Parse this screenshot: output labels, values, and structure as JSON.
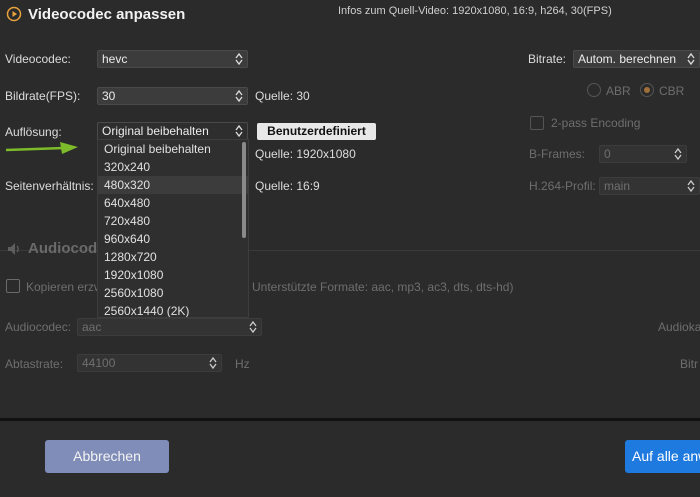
{
  "title": "Videocodec anpassen",
  "source_info": "Infos zum Quell-Video: 1920x1080, 16:9, h264, 30(FPS)",
  "video": {
    "codec_label": "Videocodec:",
    "codec_value": "hevc",
    "fps_label": "Bildrate(FPS):",
    "fps_value": "30",
    "fps_source": "Quelle: 30",
    "resolution_label": "Auflösung:",
    "resolution_value": "Original beibehalten",
    "custom_button": "Benutzerdefiniert",
    "resolution_source": "Quelle: 1920x1080",
    "aspect_label": "Seitenverhältnis:",
    "aspect_source": "Quelle: 16:9"
  },
  "resolution_options": [
    "Original beibehalten",
    "320x240",
    "480x320",
    "640x480",
    "720x480",
    "960x640",
    "1280x720",
    "1920x1080",
    "2560x1080",
    "2560x1440 (2K)"
  ],
  "resolution_highlighted_index": 2,
  "bitrate": {
    "label": "Bitrate:",
    "value": "Autom. berechnen",
    "abr": "ABR",
    "cbr": "CBR",
    "two_pass": "2-pass Encoding",
    "bframes_label": "B-Frames:",
    "bframes_value": "0",
    "profile_label": "H.264-Profil:",
    "profile_value": "main"
  },
  "audio": {
    "heading": "Audiocodec",
    "copy_label": "Kopieren erzw",
    "supported_formats": "Unterstützte Formate: aac, mp3, ac3, dts, dts-hd)",
    "codec_label": "Audiocodec:",
    "codec_value": "aac",
    "right_label": "Audioka",
    "samplerate_label": "Abtastrate:",
    "samplerate_value": "44100",
    "samplerate_unit": "Hz",
    "bitrate_right_label": "Bitr"
  },
  "footer": {
    "cancel": "Abbrechen",
    "apply_all": "Auf alle anw"
  },
  "colors": {
    "accent_blue": "#1f7ae0",
    "cancel_button": "#7f8db8",
    "arrow_green": "#7dbb2a",
    "icon_orange": "#e8a33b"
  }
}
